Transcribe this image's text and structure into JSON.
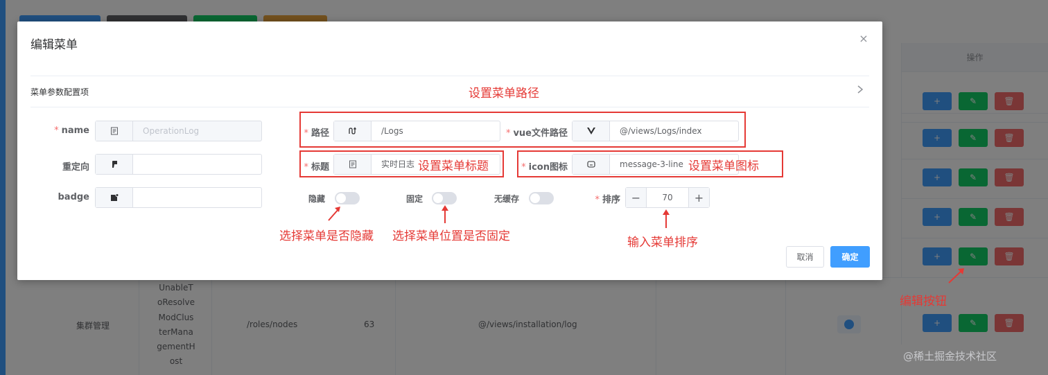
{
  "background": {
    "table_header_operations": "操作",
    "row": {
      "name": "集群管理",
      "component_wrapped": [
        "UnableT",
        "oResolve",
        "ModClus",
        "terMana",
        "gementH",
        "ost"
      ],
      "path": "/roles/nodes",
      "sort": "63",
      "file": "@/views/installation/log"
    },
    "op_icons": {
      "add": "+",
      "edit": "✎",
      "delete": "🗑"
    }
  },
  "dialog": {
    "title": "编辑菜单",
    "close_icon": "×",
    "section_label": "菜单参数配置项",
    "fields": {
      "name_label": "name",
      "name_value": "OperationLog",
      "redirect_label": "重定向",
      "redirect_value": "",
      "badge_label": "badge",
      "badge_value": "",
      "path_label": "路径",
      "path_value": "/Logs",
      "vue_path_label": "vue文件路径",
      "vue_path_value": "@/views/Logs/index",
      "title_label": "标题",
      "title_value": "实时日志",
      "icon_label": "icon图标",
      "icon_value": "message-3-line",
      "hidden_label": "隐藏",
      "fixed_label": "固定",
      "nocache_label": "无缓存",
      "sort_label": "排序",
      "sort_value": "70"
    },
    "switches": {
      "hidden": false,
      "fixed": false,
      "nocache": false
    },
    "buttons": {
      "cancel": "取消",
      "confirm": "确定"
    }
  },
  "annotations": {
    "set_path": "设置菜单路径",
    "set_title": "设置菜单标题",
    "set_icon": "设置菜单图标",
    "choose_hidden": "选择菜单是否隐藏",
    "choose_fixed": "选择菜单位置是否固定",
    "input_sort": "输入菜单排序",
    "edit_button": "编辑按钮"
  },
  "watermark": "@稀土掘金技术社区",
  "colors": {
    "primary": "#409eff",
    "success": "#13ce66",
    "danger": "#f56c6c",
    "annotation": "#e53935"
  }
}
